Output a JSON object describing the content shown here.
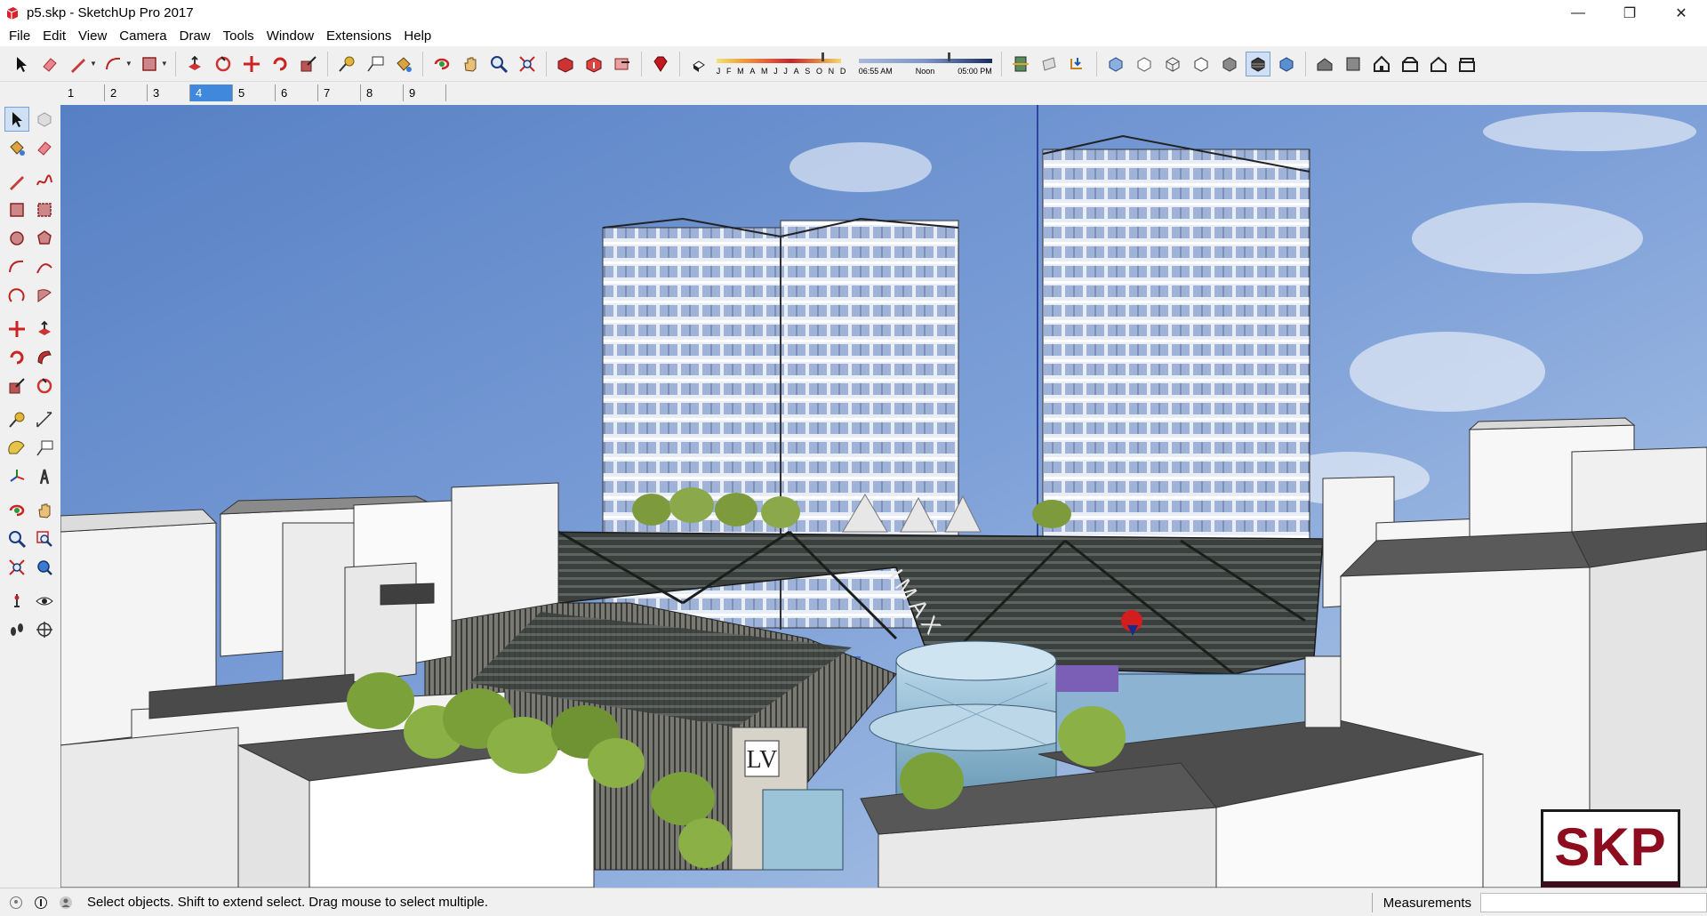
{
  "window": {
    "title": "p5.skp - SketchUp Pro 2017",
    "controls": {
      "minimize": "—",
      "maximize": "❐",
      "close": "✕"
    }
  },
  "menu": [
    "File",
    "Edit",
    "View",
    "Camera",
    "Draw",
    "Tools",
    "Window",
    "Extensions",
    "Help"
  ],
  "toolbar": {
    "shadow": {
      "months": [
        "J",
        "F",
        "M",
        "A",
        "M",
        "J",
        "J",
        "A",
        "S",
        "O",
        "N",
        "D"
      ],
      "time_start": "06:55 AM",
      "time_mid": "Noon",
      "time_end": "05:00 PM"
    }
  },
  "scenes": {
    "tabs": [
      "1",
      "2",
      "3",
      "4",
      "5",
      "6",
      "7",
      "8",
      "9"
    ],
    "active": "4"
  },
  "viewport": {
    "sign_text": "IMAX",
    "watermark": "SKP"
  },
  "statusbar": {
    "message": "Select objects. Shift to extend select. Drag mouse to select multiple.",
    "measurements_label": "Measurements",
    "measurements_value": ""
  }
}
